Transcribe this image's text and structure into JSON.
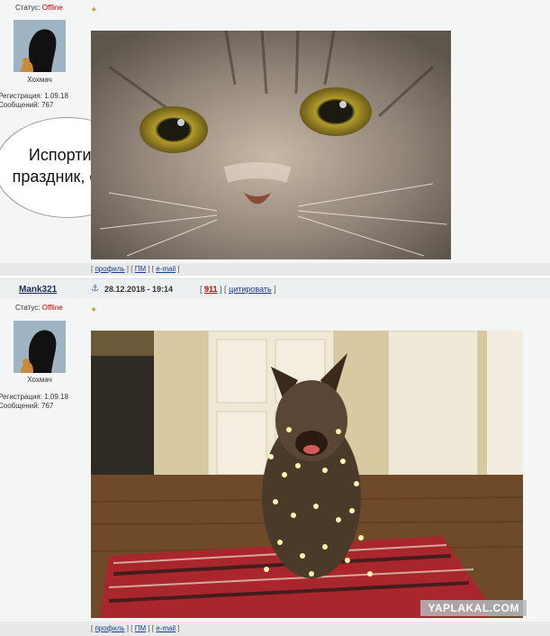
{
  "post1": {
    "status_label": "Статус:",
    "status_value": "Offline",
    "username_caption": "Хохмач",
    "registration": "Регистрация: 1.09.18",
    "messages": "Сообщений: 767",
    "bubble_line1": "Испортили",
    "bubble_line2": "праздник, суки!",
    "links": {
      "profile": "профиль",
      "pm": "ПМ",
      "email": "e-mail"
    }
  },
  "post2": {
    "author": "Mank321",
    "date": "28.12.2018 - 19:14",
    "post_number": "911",
    "cite": "цитировать",
    "status_label": "Статус:",
    "status_value": "Offline",
    "username_caption": "Хохмач",
    "registration": "Регистрация: 1.09.18",
    "messages": "Сообщений: 767",
    "links": {
      "profile": "профиль",
      "pm": "ПМ",
      "email": "e-mail"
    }
  },
  "watermark": "YAPLAKAL.COM",
  "colors": {
    "offline": "#cc0000",
    "link": "#1a3a8a",
    "post_number": "#cc0000"
  }
}
